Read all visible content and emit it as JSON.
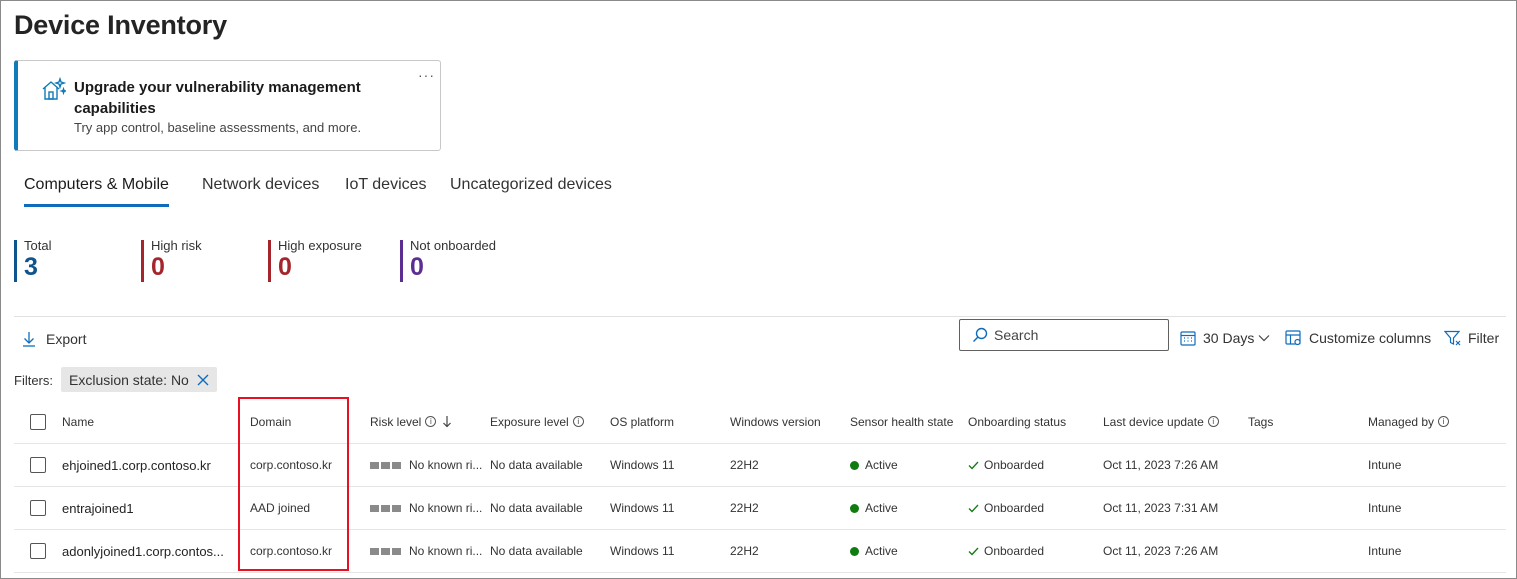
{
  "page": {
    "title": "Device Inventory"
  },
  "banner": {
    "title": "Upgrade your vulnerability management capabilities",
    "subtitle": "Try app control, baseline assessments, and more.",
    "more": "···",
    "icon": "house-sparkle-icon",
    "accent": "#0f7bb8"
  },
  "tabs": [
    {
      "label": "Computers & Mobile",
      "active": true
    },
    {
      "label": "Network devices",
      "active": false
    },
    {
      "label": "IoT devices",
      "active": false
    },
    {
      "label": "Uncategorized devices",
      "active": false
    }
  ],
  "stats": [
    {
      "label": "Total",
      "value": "3",
      "color": "#0f548c"
    },
    {
      "label": "High risk",
      "value": "0",
      "color": "#a4262c"
    },
    {
      "label": "High exposure",
      "value": "0",
      "color": "#a4262c"
    },
    {
      "label": "Not onboarded",
      "value": "0",
      "color": "#5c2e91"
    }
  ],
  "toolbar": {
    "export_label": "Export",
    "search_placeholder": "Search",
    "date_range": "30 Days",
    "customize_label": "Customize columns",
    "filter_label": "Filter"
  },
  "filters": {
    "label": "Filters:",
    "chips": [
      {
        "label": "Exclusion state: No"
      }
    ]
  },
  "table": {
    "columns": [
      {
        "label": "Name"
      },
      {
        "label": "Domain"
      },
      {
        "label": "Risk level"
      },
      {
        "label": "Exposure level"
      },
      {
        "label": "OS platform"
      },
      {
        "label": "Windows version"
      },
      {
        "label": "Sensor health state"
      },
      {
        "label": "Onboarding status"
      },
      {
        "label": "Last device update"
      },
      {
        "label": "Tags"
      },
      {
        "label": "Managed by"
      }
    ],
    "rows": [
      {
        "name": "ehjoined1.corp.contoso.kr",
        "domain": "corp.contoso.kr",
        "risk": "No known ri...",
        "exposure": "No data available",
        "os": "Windows 11",
        "version": "22H2",
        "sensor": "Active",
        "onboarding": "Onboarded",
        "last_update": "Oct 11, 2023 7:26 AM",
        "tags": "",
        "managed_by": "Intune"
      },
      {
        "name": "entrajoined1",
        "domain": "AAD joined",
        "risk": "No known ri...",
        "exposure": "No data available",
        "os": "Windows 11",
        "version": "22H2",
        "sensor": "Active",
        "onboarding": "Onboarded",
        "last_update": "Oct 11, 2023 7:31 AM",
        "tags": "",
        "managed_by": "Intune"
      },
      {
        "name": "adonlyjoined1.corp.contos...",
        "domain": "corp.contoso.kr",
        "risk": "No known ri...",
        "exposure": "No data available",
        "os": "Windows 11",
        "version": "22H2",
        "sensor": "Active",
        "onboarding": "Onboarded",
        "last_update": "Oct 11, 2023 7:26 AM",
        "tags": "",
        "managed_by": "Intune"
      }
    ]
  },
  "colors": {
    "active_tab": "#0f6cbd",
    "sensor_active": "#107c10",
    "onboarded_check": "#107c10",
    "highlight": "#e81123"
  }
}
